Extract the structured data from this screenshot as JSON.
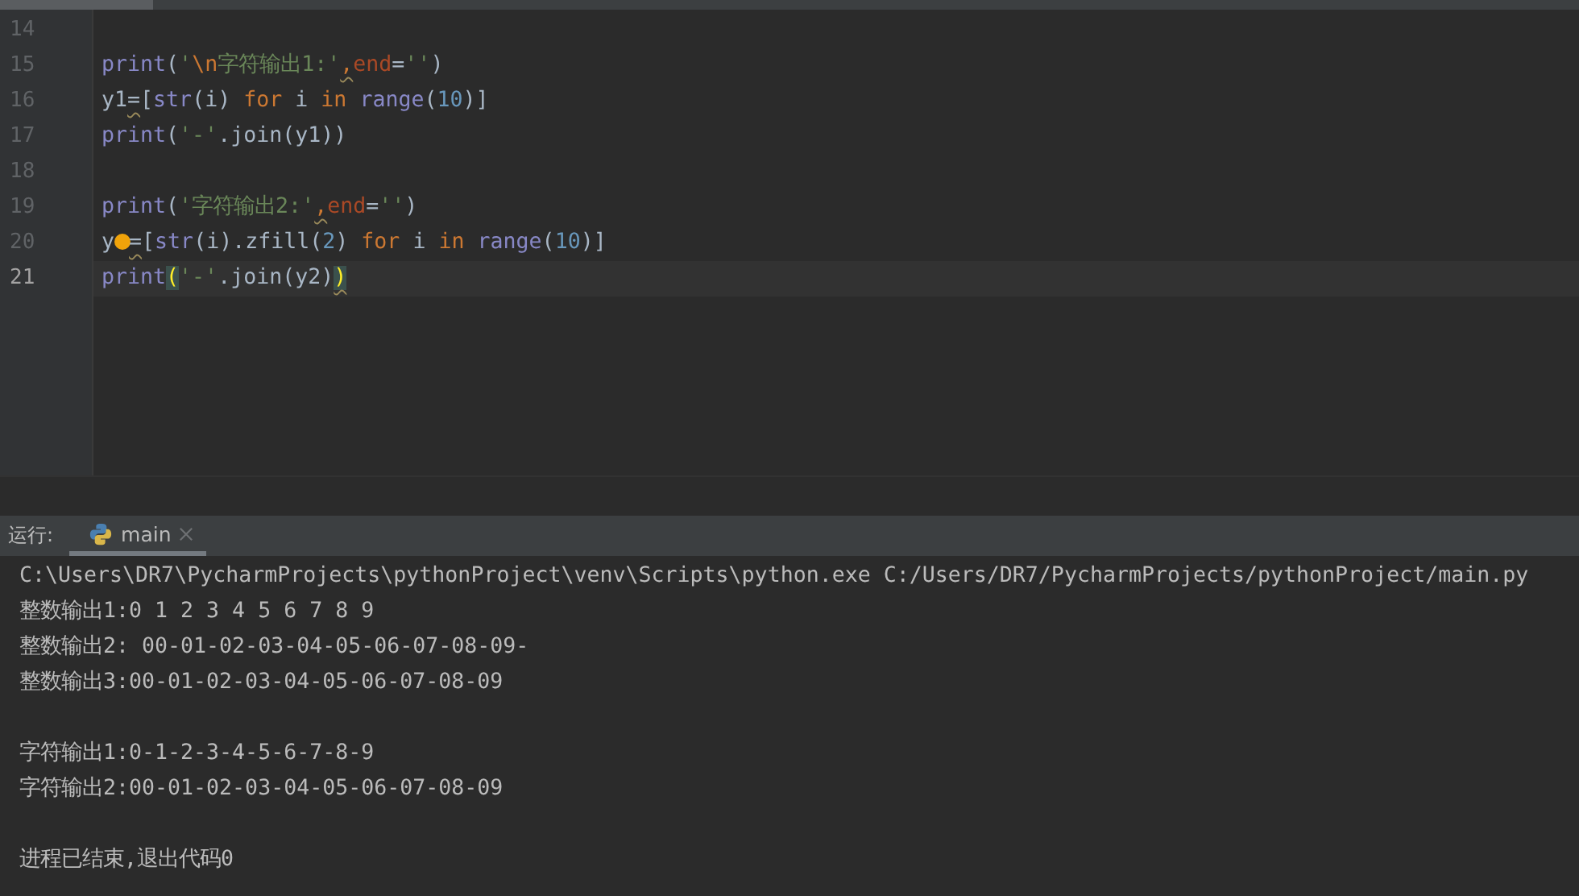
{
  "editor": {
    "lines": [
      {
        "number": "14",
        "current": false
      },
      {
        "number": "15",
        "current": false,
        "tokens": [
          {
            "t": "print",
            "kind": "builtin"
          },
          {
            "t": "(",
            "kind": "plain"
          },
          {
            "t": "'",
            "kind": "string"
          },
          {
            "t": "\\n",
            "kind": "escape"
          },
          {
            "t": "字符输出1:'",
            "kind": "string"
          },
          {
            "t": ",",
            "kind": "keyword",
            "warn": true
          },
          {
            "t": "end",
            "kind": "param"
          },
          {
            "t": "=",
            "kind": "plain"
          },
          {
            "t": "''",
            "kind": "string"
          },
          {
            "t": ")",
            "kind": "plain"
          }
        ]
      },
      {
        "number": "16",
        "current": false,
        "tokens": [
          {
            "t": "y1",
            "kind": "plain"
          },
          {
            "t": "=",
            "kind": "plain",
            "warn": true
          },
          {
            "t": "[",
            "kind": "plain"
          },
          {
            "t": "str",
            "kind": "builtin"
          },
          {
            "t": "(i) ",
            "kind": "plain"
          },
          {
            "t": "for",
            "kind": "keyword"
          },
          {
            "t": " i ",
            "kind": "plain"
          },
          {
            "t": "in ",
            "kind": "keyword"
          },
          {
            "t": "range",
            "kind": "builtin"
          },
          {
            "t": "(",
            "kind": "plain"
          },
          {
            "t": "10",
            "kind": "number"
          },
          {
            "t": ")]",
            "kind": "plain"
          }
        ]
      },
      {
        "number": "17",
        "current": false,
        "tokens": [
          {
            "t": "print",
            "kind": "builtin"
          },
          {
            "t": "(",
            "kind": "plain"
          },
          {
            "t": "'-'",
            "kind": "string"
          },
          {
            "t": ".join(y1))",
            "kind": "plain"
          }
        ]
      },
      {
        "number": "18",
        "current": false
      },
      {
        "number": "19",
        "current": false,
        "tokens": [
          {
            "t": "print",
            "kind": "builtin"
          },
          {
            "t": "(",
            "kind": "plain"
          },
          {
            "t": "'字符输出2:'",
            "kind": "string"
          },
          {
            "t": ",",
            "kind": "keyword",
            "warn": true
          },
          {
            "t": "end",
            "kind": "param"
          },
          {
            "t": "=",
            "kind": "plain"
          },
          {
            "t": "''",
            "kind": "string"
          },
          {
            "t": ")",
            "kind": "plain"
          }
        ]
      },
      {
        "number": "20",
        "current": false,
        "tokens": [
          {
            "t": "y",
            "kind": "plain"
          },
          {
            "kind": "bulb"
          },
          {
            "t": "=",
            "kind": "plain",
            "warn": true
          },
          {
            "t": "[",
            "kind": "plain"
          },
          {
            "t": "str",
            "kind": "builtin"
          },
          {
            "t": "(i).zfill(",
            "kind": "plain"
          },
          {
            "t": "2",
            "kind": "number"
          },
          {
            "t": ") ",
            "kind": "plain"
          },
          {
            "t": "for",
            "kind": "keyword"
          },
          {
            "t": " i ",
            "kind": "plain"
          },
          {
            "t": "in ",
            "kind": "keyword"
          },
          {
            "t": "range",
            "kind": "builtin"
          },
          {
            "t": "(",
            "kind": "plain"
          },
          {
            "t": "10",
            "kind": "number"
          },
          {
            "t": ")]",
            "kind": "plain"
          }
        ]
      },
      {
        "number": "21",
        "current": true,
        "tokens": [
          {
            "t": "print",
            "kind": "builtin"
          },
          {
            "t": "(",
            "kind": "match"
          },
          {
            "t": "'-'",
            "kind": "string"
          },
          {
            "t": ".join(y2)",
            "kind": "plain"
          },
          {
            "t": ")",
            "kind": "match",
            "warn": true
          }
        ]
      }
    ]
  },
  "run_panel": {
    "label": "运行:",
    "tabs": [
      {
        "label": "main",
        "selected": true
      }
    ]
  },
  "console": {
    "lines": [
      {
        "kind": "text",
        "text": "C:\\Users\\DR7\\PycharmProjects\\pythonProject\\venv\\Scripts\\python.exe C:/Users/DR7/PycharmProjects/pythonProject/main.py"
      },
      {
        "kind": "text",
        "text": "整数输出1:0 1 2 3 4 5 6 7 8 9"
      },
      {
        "kind": "text",
        "text": "整数输出2: 00-01-02-03-04-05-06-07-08-09-"
      },
      {
        "kind": "text",
        "text": "整数输出3:00-01-02-03-04-05-06-07-08-09"
      },
      {
        "kind": "blank"
      },
      {
        "kind": "text",
        "text": "字符输出1:0-1-2-3-4-5-6-7-8-9"
      },
      {
        "kind": "text",
        "text": "字符输出2:00-01-02-03-04-05-06-07-08-09"
      },
      {
        "kind": "blank"
      },
      {
        "kind": "text",
        "text": "进程已结束,退出代码0"
      }
    ]
  }
}
